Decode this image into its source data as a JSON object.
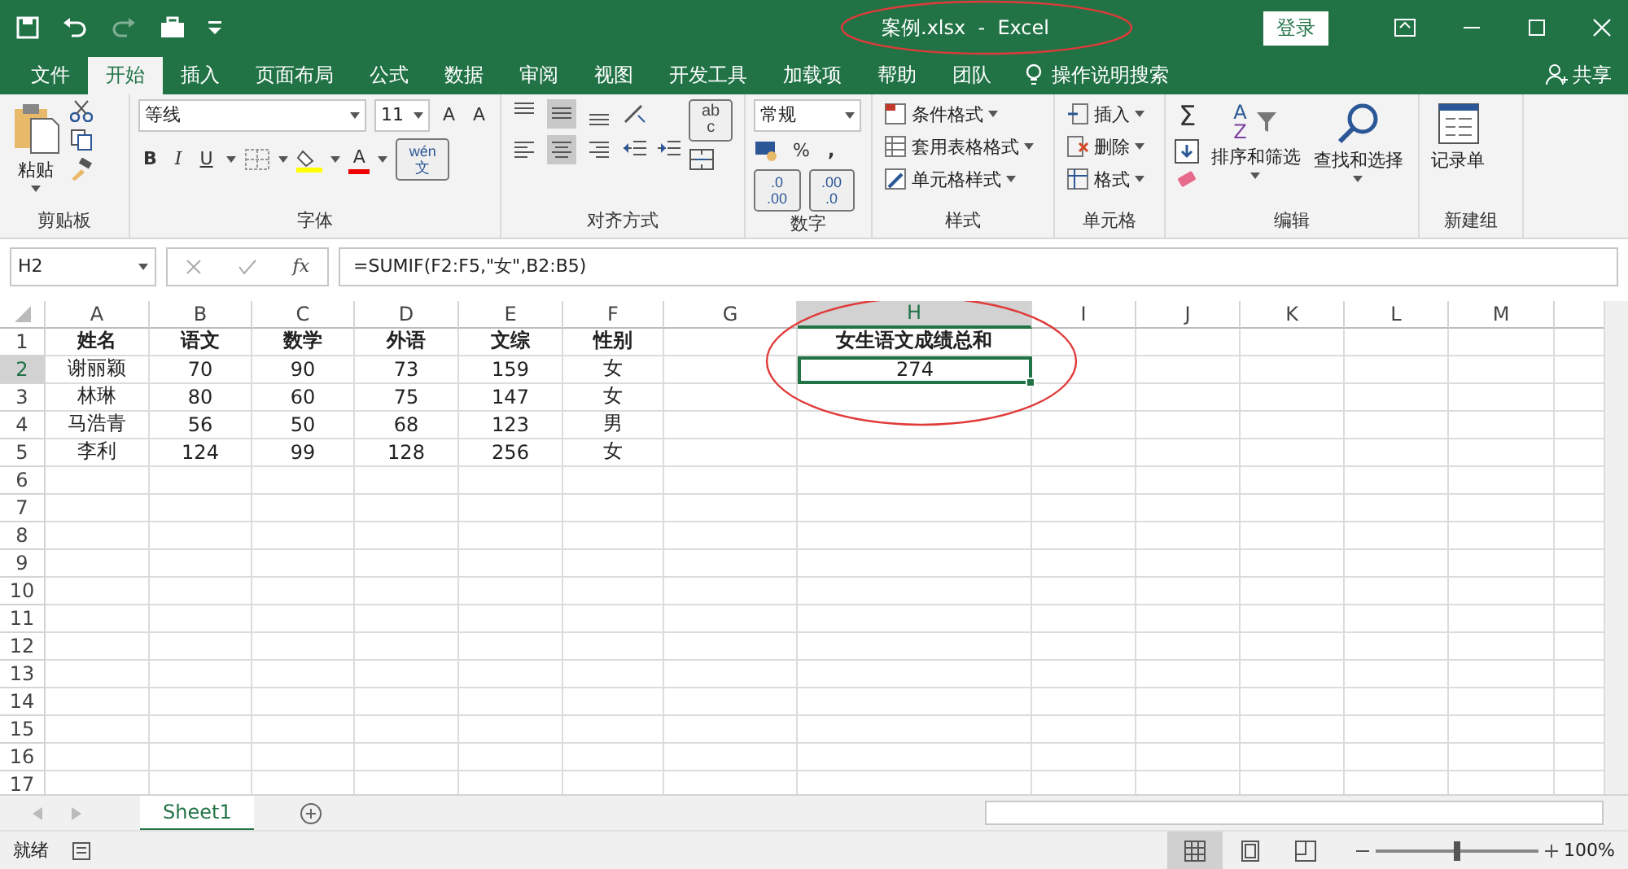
{
  "title_bar": {
    "title": "案例.xlsx  -  Excel",
    "login": "登录",
    "annotation": {
      "kind": "ellipse"
    }
  },
  "menu_tabs": [
    {
      "label": "文件",
      "selected": false
    },
    {
      "label": "开始",
      "selected": true
    },
    {
      "label": "插入",
      "selected": false
    },
    {
      "label": "页面布局",
      "selected": false
    },
    {
      "label": "公式",
      "selected": false
    },
    {
      "label": "数据",
      "selected": false
    },
    {
      "label": "审阅",
      "selected": false
    },
    {
      "label": "视图",
      "selected": false
    },
    {
      "label": "开发工具",
      "selected": false
    },
    {
      "label": "加载项",
      "selected": false
    },
    {
      "label": "帮助",
      "selected": false
    },
    {
      "label": "团队",
      "selected": false
    }
  ],
  "tell_me": "操作说明搜索",
  "share": "共享",
  "ribbon": {
    "clipboard": {
      "label": "剪贴板",
      "paste": "粘贴"
    },
    "font": {
      "label": "字体",
      "font_name": "等线",
      "font_size": "11",
      "grow": "A",
      "shrink": "A",
      "bold": "B",
      "italic": "I",
      "underline": "U",
      "font_color": "A",
      "phonetic_top": "wén",
      "phonetic_bottom": "文"
    },
    "alignment": {
      "label": "对齐方式",
      "wrap_top": "ab",
      "wrap_bottom": "c",
      "vertical": [
        {
          "kind": "top",
          "selected": false
        },
        {
          "kind": "middle",
          "selected": true
        },
        {
          "kind": "bottom",
          "selected": false
        }
      ],
      "horizontal": [
        {
          "kind": "left",
          "selected": false
        },
        {
          "kind": "center",
          "selected": true
        },
        {
          "kind": "right",
          "selected": false
        }
      ]
    },
    "number": {
      "label": "数字",
      "format": "常规",
      "percent": "%",
      "comma": ",",
      "increase_decimal": [
        ".0",
        ".00"
      ],
      "decrease_decimal": [
        ".00",
        ".0"
      ]
    },
    "styles": {
      "label": "样式",
      "buttons": [
        "条件格式",
        "套用表格格式",
        "单元格样式"
      ]
    },
    "cells": {
      "label": "单元格",
      "buttons": [
        "插入",
        "删除",
        "格式"
      ]
    },
    "editing": {
      "label": "编辑",
      "sum": "Σ",
      "sort_icon_top": "A",
      "sort_icon_bottom": "Z",
      "sort": "排序和筛选",
      "find": "查找和选择"
    },
    "new_group": {
      "label": "新建组",
      "form": "记录单"
    }
  },
  "formula_bar": {
    "name_box": "H2",
    "fx": "fx",
    "formula": "=SUMIF(F2:F5,\"女\",B2:B5)"
  },
  "columns": [
    {
      "label": "A",
      "selected": false
    },
    {
      "label": "B",
      "selected": false
    },
    {
      "label": "C",
      "selected": false
    },
    {
      "label": "D",
      "selected": false
    },
    {
      "label": "E",
      "selected": false
    },
    {
      "label": "F",
      "selected": false
    },
    {
      "label": "G",
      "selected": false
    },
    {
      "label": "H",
      "selected": true
    },
    {
      "label": "I",
      "selected": false
    },
    {
      "label": "J",
      "selected": false
    },
    {
      "label": "K",
      "selected": false
    },
    {
      "label": "L",
      "selected": false
    },
    {
      "label": "M",
      "selected": false
    }
  ],
  "row_headers": [
    {
      "label": "1",
      "selected": false
    },
    {
      "label": "2",
      "selected": true
    },
    {
      "label": "3",
      "selected": false
    },
    {
      "label": "4",
      "selected": false
    },
    {
      "label": "5",
      "selected": false
    },
    {
      "label": "6",
      "selected": false
    },
    {
      "label": "7",
      "selected": false
    },
    {
      "label": "8",
      "selected": false
    },
    {
      "label": "9",
      "selected": false
    },
    {
      "label": "10",
      "selected": false
    },
    {
      "label": "11",
      "selected": false
    },
    {
      "label": "12",
      "selected": false
    },
    {
      "label": "13",
      "selected": false
    },
    {
      "label": "14",
      "selected": false
    },
    {
      "label": "15",
      "selected": false
    },
    {
      "label": "16",
      "selected": false
    },
    {
      "label": "17",
      "selected": false
    }
  ],
  "table": {
    "header": [
      "姓名",
      "语文",
      "数学",
      "外语",
      "文综",
      "性别"
    ],
    "rows": [
      [
        "谢丽颖",
        "70",
        "90",
        "73",
        "159",
        "女"
      ],
      [
        "林琳",
        "80",
        "60",
        "75",
        "147",
        "女"
      ],
      [
        "马浩青",
        "56",
        "50",
        "68",
        "123",
        "男"
      ],
      [
        "李利",
        "124",
        "99",
        "128",
        "256",
        "女"
      ]
    ]
  },
  "summary": {
    "heading": "女生语文成绩总和",
    "value": "274",
    "selected": true,
    "annotation": {
      "kind": "ellipse"
    }
  },
  "sheet_tabs": [
    {
      "label": "Sheet1",
      "selected": true
    }
  ],
  "status_bar": {
    "status": "就绪",
    "views": [
      {
        "kind": "normal",
        "selected": true
      },
      {
        "kind": "page_layout",
        "selected": false
      },
      {
        "kind": "page_break",
        "selected": false
      }
    ],
    "zoom_slider": {
      "level": 0.5
    },
    "zoom": "100%"
  }
}
